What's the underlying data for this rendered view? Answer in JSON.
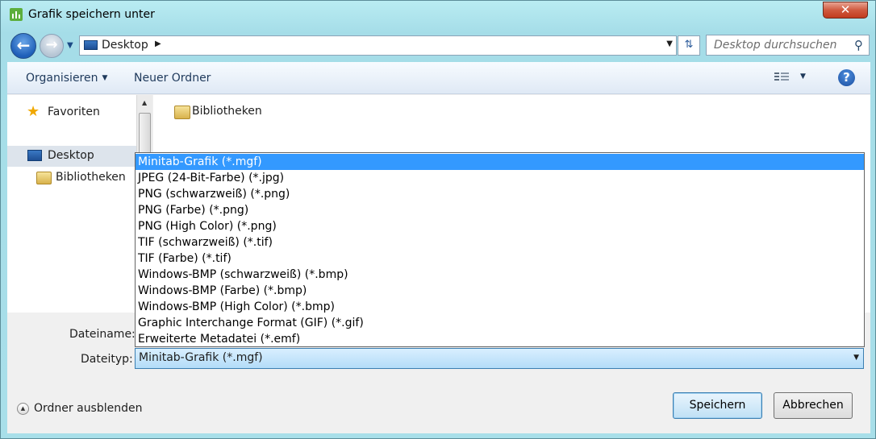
{
  "window": {
    "title": "Grafik speichern unter",
    "close_label": "✕"
  },
  "address": {
    "location": "Desktop",
    "search_placeholder": "Desktop durchsuchen"
  },
  "toolbar": {
    "organize_label": "Organisieren",
    "new_folder_label": "Neuer Ordner",
    "help_label": "?"
  },
  "nav": {
    "favorites": "Favoriten",
    "desktop": "Desktop",
    "libraries": "Bibliotheken"
  },
  "files": {
    "items": [
      "Bibliotheken"
    ]
  },
  "form": {
    "filename_label": "Dateiname:",
    "filetype_label": "Dateityp:",
    "filetype_value": "Minitab-Grafik (*.mgf)"
  },
  "filetype_options": [
    "Minitab-Grafik (*.mgf)",
    "JPEG (24-Bit-Farbe) (*.jpg)",
    "PNG (schwarzweiß) (*.png)",
    "PNG (Farbe) (*.png)",
    "PNG (High Color) (*.png)",
    "TIF (schwarzweiß) (*.tif)",
    "TIF (Farbe) (*.tif)",
    "Windows-BMP (schwarzweiß) (*.bmp)",
    "Windows-BMP (Farbe) (*.bmp)",
    "Windows-BMP (High Color) (*.bmp)",
    "Graphic Interchange Format (GIF) (*.gif)",
    "Erweiterte Metadatei (*.emf)"
  ],
  "footer": {
    "hide_folders_label": "Ordner ausblenden",
    "save_label": "Speichern",
    "cancel_label": "Abbrechen"
  },
  "colors": {
    "selection": "#3399ff",
    "frame": "#a8dfe9"
  }
}
